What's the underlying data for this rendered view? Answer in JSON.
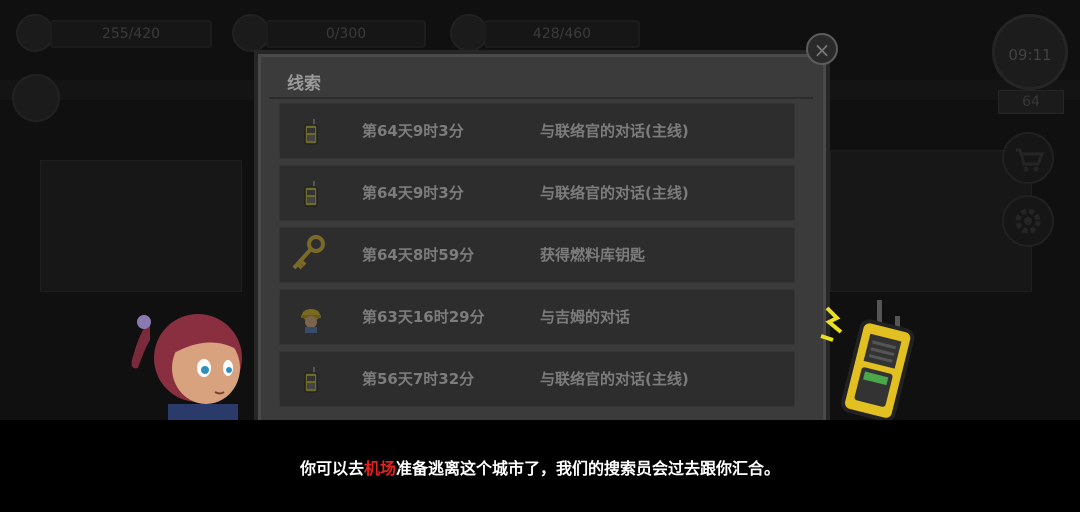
{
  "hud": {
    "stat1": "255/420",
    "stat2": "0/300",
    "stat3": "428/460",
    "clock": "09:11",
    "level": "64"
  },
  "panel": {
    "title": "线索",
    "close_label": "×",
    "entries": [
      {
        "icon": "walkie-talkie-icon",
        "time": "第64天9时3分",
        "desc": "与联络官的对话(主线)"
      },
      {
        "icon": "walkie-talkie-icon",
        "time": "第64天9时3分",
        "desc": "与联络官的对话(主线)"
      },
      {
        "icon": "key-icon",
        "time": "第64天8时59分",
        "desc": "获得燃料库钥匙"
      },
      {
        "icon": "hardhat-man-icon",
        "time": "第63天16时29分",
        "desc": "与吉姆的对话"
      },
      {
        "icon": "walkie-talkie-icon",
        "time": "第56天7时32分",
        "desc": "与联络官的对话(主线)"
      }
    ]
  },
  "dialog": {
    "before": "你可以去",
    "highlight": "机场",
    "after": "准备逃离这个城市了，我们的搜索员会过去跟你汇合。",
    "highlight_color": "#e12222"
  }
}
